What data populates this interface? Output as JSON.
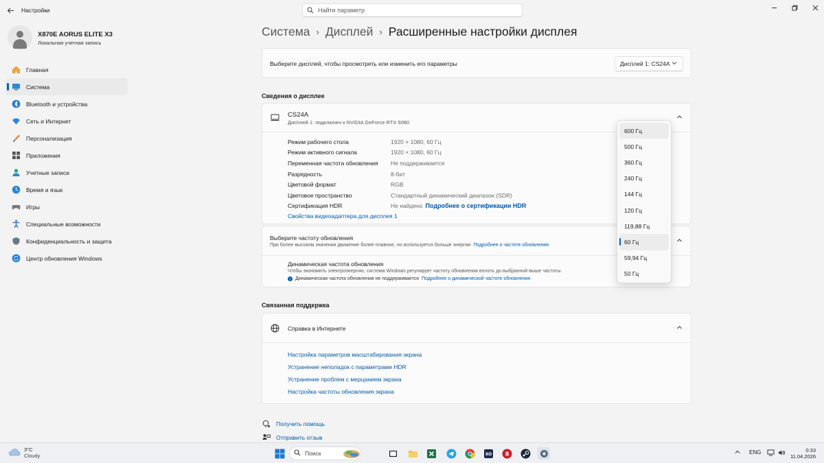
{
  "app": {
    "title": "Настройки",
    "search_placeholder": "Найти параметр"
  },
  "profile": {
    "name": "X870E AORUS ELITE X3",
    "account_type": "Локальная учетная запись"
  },
  "sidebar": {
    "items": [
      {
        "label": "Главная",
        "icon": "home-icon",
        "active": false
      },
      {
        "label": "Система",
        "icon": "system-icon",
        "active": true
      },
      {
        "label": "Bluetooth и устройства",
        "icon": "bluetooth-icon",
        "active": false
      },
      {
        "label": "Сеть и Интернет",
        "icon": "wifi-icon",
        "active": false
      },
      {
        "label": "Персонализация",
        "icon": "brush-icon",
        "active": false
      },
      {
        "label": "Приложения",
        "icon": "apps-icon",
        "active": false
      },
      {
        "label": "Учетные записи",
        "icon": "accounts-icon",
        "active": false
      },
      {
        "label": "Время и язык",
        "icon": "globe-clock-icon",
        "active": false
      },
      {
        "label": "Игры",
        "icon": "gamepad-icon",
        "active": false
      },
      {
        "label": "Специальные возможности",
        "icon": "accessibility-icon",
        "active": false
      },
      {
        "label": "Конфиденциальность и защита",
        "icon": "shield-icon",
        "active": false
      },
      {
        "label": "Центр обновления Windows",
        "icon": "update-icon",
        "active": false
      }
    ]
  },
  "breadcrumb": {
    "part1": "Система",
    "part2": "Дисплей",
    "current": "Расширенные настройки дисплея"
  },
  "display_select": {
    "label": "Выберите дисплей, чтобы просмотреть или изменить его параметры",
    "value": "Дисплей 1: CS24A"
  },
  "display_info": {
    "section_title": "Сведения о дисплее",
    "monitor_name": "CS24A",
    "monitor_sub": "Дисплей 1: подключен к NVIDIA GeForce RTX 5080",
    "rows": [
      {
        "key": "Режим рабочего стола",
        "value": "1920 × 1080, 60 Гц"
      },
      {
        "key": "Режим активного сигнала",
        "value": "1920 × 1080, 60 Гц"
      },
      {
        "key": "Переменная частота обновления",
        "value": "Не поддерживается"
      },
      {
        "key": "Разрядность",
        "value": "8-бит"
      },
      {
        "key": "Цветовой формат",
        "value": "RGB"
      },
      {
        "key": "Цветовое пространство",
        "value": "Стандартный динамический диапазон (SDR)"
      },
      {
        "key": "Сертификация HDR",
        "value": "Не найдено",
        "link": "Подробнее о сертификации HDR"
      }
    ],
    "adapter_link": "Свойства видеоадаптера для дисплея 1"
  },
  "refresh_rate": {
    "title": "Выберите частоту обновления",
    "description": "При более высоком значении движение более плавное, но используется больше энергии",
    "link": "Подробнее о частоте обновления",
    "dynamic_title": "Динамическая частота обновления",
    "dynamic_desc": "Чтобы экономить электроэнергию, система Windows регулирует частоту обновления вплоть до выбранной выше частоты.",
    "dynamic_note": "Динамическая частота обновления не поддерживается",
    "dynamic_link": "Подробнее о динамической частоте обновления",
    "options": [
      "600 Гц",
      "500 Гц",
      "360 Гц",
      "240 Гц",
      "144 Гц",
      "120 Гц",
      "119,88 Гц",
      "60 Гц",
      "59,94 Гц",
      "50 Гц"
    ],
    "selected": "60 Гц"
  },
  "support": {
    "section_title": "Связанная поддержка",
    "card_title": "Справка в Интернете",
    "links": [
      "Настройка параметров масштабирования экрана",
      "Устранение неполадок с параметрами HDR",
      "Устранение проблем с мерцанием экрана",
      "Настройка частоты обновления экрана"
    ]
  },
  "footer": {
    "get_help": "Получить помощь",
    "feedback": "Отправить отзыв"
  },
  "taskbar": {
    "weather_temp": "3°C",
    "weather_cond": "Cloudy",
    "search_label": "Поиск",
    "language": "ENG",
    "time": "0:33",
    "date": "11.04.2026"
  },
  "colors": {
    "accent": "#005fb8",
    "link": "#0058a8"
  }
}
